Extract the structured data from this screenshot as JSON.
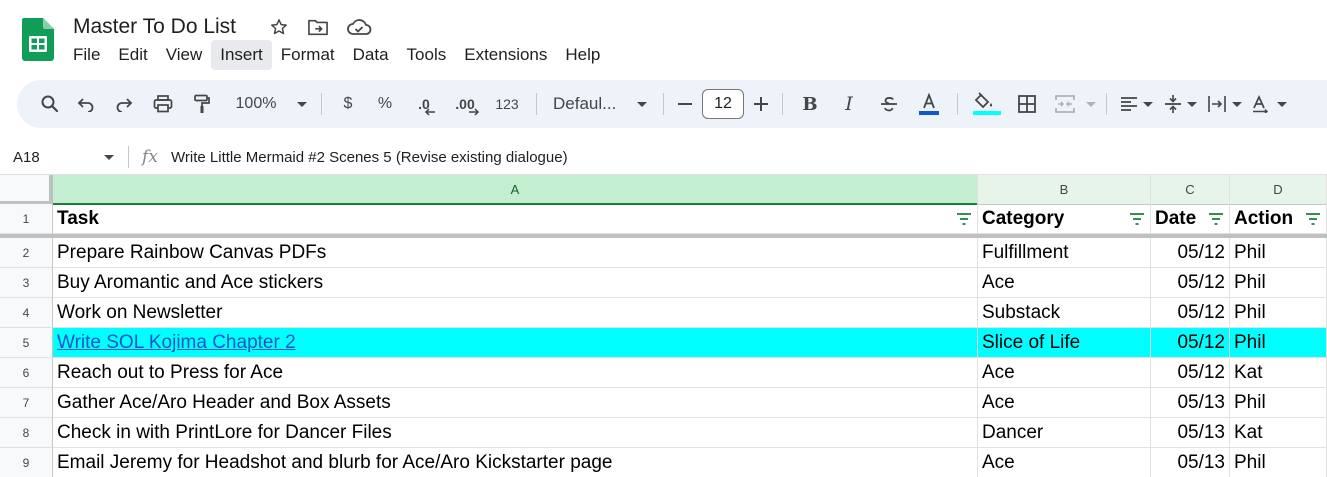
{
  "app": {
    "title": "Master To Do List",
    "accent": "#0f9d58",
    "title_icons": [
      "star-icon",
      "move-to-folder-icon",
      "cloud-saved-icon"
    ]
  },
  "menu": [
    "File",
    "Edit",
    "View",
    "Insert",
    "Format",
    "Data",
    "Tools",
    "Extensions",
    "Help"
  ],
  "menu_active": "Insert",
  "toolbar": {
    "zoom": "100%",
    "currency": "$",
    "percent": "%",
    "decrease_decimal": ".0",
    "increase_decimal": ".00",
    "number_format": "123",
    "font": "Defaul...",
    "font_size": "12",
    "text_color": "#1155cc",
    "fill_color": "#00ffff"
  },
  "formula_bar": {
    "cell_ref": "A18",
    "fx": "fx",
    "content": "Write Little Mermaid #2 Scenes 5 (Revise existing dialogue)"
  },
  "columns": [
    "A",
    "B",
    "C",
    "D"
  ],
  "rows": [
    {
      "num": "1",
      "task": "Task",
      "category": "Category",
      "date": "Date",
      "action": "Action",
      "header": true
    },
    {
      "num": "2",
      "task": "Prepare Rainbow Canvas PDFs",
      "category": "Fulfillment",
      "date": "05/12",
      "action": "Phil"
    },
    {
      "num": "3",
      "task": "Buy Aromantic and Ace stickers",
      "category": "Ace",
      "date": "05/12",
      "action": "Phil"
    },
    {
      "num": "4",
      "task": "Work on Newsletter",
      "category": "Substack",
      "date": "05/12",
      "action": "Phil"
    },
    {
      "num": "5",
      "task": "Write SOL Kojima Chapter 2",
      "category": "Slice of Life",
      "date": "05/12",
      "action": "Phil",
      "highlight": true,
      "link": true
    },
    {
      "num": "6",
      "task": "Reach out to Press for Ace",
      "category": "Ace",
      "date": "05/12",
      "action": "Kat"
    },
    {
      "num": "7",
      "task": "Gather Ace/Aro Header and Box Assets",
      "category": "Ace",
      "date": "05/13",
      "action": "Phil"
    },
    {
      "num": "8",
      "task": "Check in with PrintLore for Dancer Files",
      "category": "Dancer",
      "date": "05/13",
      "action": "Kat"
    },
    {
      "num": "9",
      "task": "Email Jeremy for Headshot and blurb for Ace/Aro Kickstarter page",
      "category": "Ace",
      "date": "05/13",
      "action": "Phil"
    }
  ],
  "highlight_color": "#00ffff",
  "link_color": "#1155cc"
}
